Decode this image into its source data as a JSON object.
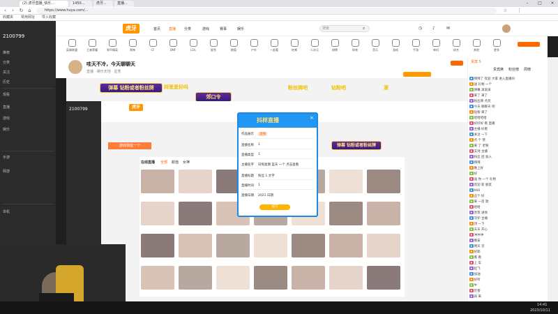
{
  "browser": {
    "tabs": [
      {
        "label": "(2) 虎牙直播_快乐..."
      },
      {
        "label": "1450..."
      },
      {
        "label": "虎牙..."
      },
      {
        "label": "直播..."
      }
    ],
    "url": "https://www.huya.com/...",
    "bookmarks": [
      "收藏夹",
      "常用网址",
      "导入收藏"
    ]
  },
  "sidebar": {
    "items": [
      "推荐",
      "分类",
      "关注",
      "历史",
      "观看",
      "直播",
      "游戏",
      "娱乐",
      "手游",
      "网游",
      "单机"
    ]
  },
  "topnav": {
    "logo": "虎牙",
    "links": [
      "首页",
      "直播",
      "分类",
      "游戏",
      "赛事",
      "娱乐"
    ],
    "search_placeholder": "搜索"
  },
  "categories": [
    "英雄联盟",
    "王者荣耀",
    "和平精英",
    "原神",
    "CF",
    "DNF",
    "LOL",
    "星秀",
    "颜值",
    "户外",
    "一起看",
    "吃喝",
    "二次元",
    "棋牌",
    "体育",
    "音乐",
    "游戏",
    "手游",
    "单机",
    "综合",
    "其他",
    "更多"
  ],
  "room": {
    "title": "哇天不冷，今天聊聊天",
    "subtitle": "直播 · 娱乐天地 · 星秀"
  },
  "overlay": {
    "ribbon1": "弹幕 钻粉或者粉丝牌",
    "text1": "拜里爱好吗",
    "ribbon2": "郊口令",
    "text2": "粉丝牌吧",
    "text3": "钻粉吧",
    "text4": "滚"
  },
  "inner": {
    "timer": "2100799",
    "banner": "弹幕 钻粉或者粉丝牌",
    "tag": "游戏我蓝一个",
    "section": "在线直播",
    "filters": [
      "全部",
      "颜值",
      "女神",
      "舞蹈",
      "唱歌",
      "聊天"
    ]
  },
  "dialog": {
    "title": "抖样直播",
    "tabs": [
      "作品展示",
      "直播"
    ],
    "rows": [
      {
        "label": "直播名称",
        "value": "1"
      },
      {
        "label": "直播类型",
        "value": "1"
      },
      {
        "label": "主播名字",
        "value": "日照星期 蓝天 一个 点击查看"
      },
      {
        "label": "直播标题",
        "value": "粉丝 1.文字"
      },
      {
        "label": "直播时间",
        "value": "1"
      },
      {
        "label": "直播日期",
        "value": "2021 日期"
      }
    ],
    "submit": "提交"
  },
  "chat": {
    "header": "贵宾 5",
    "tabs": [
      "贵宾席",
      "粉丝榜",
      "周榜"
    ],
    "lines": [
      "拜拜了 欢迎 大家 进入直播间",
      "送 礼物 一个",
      "弹幕 滚滚滚",
      "来了 来了",
      "粉丝牌 点亮",
      "今天 聊聊天 吧",
      "钻粉 来了",
      "哈哈哈哈",
      "好好好 看 直播",
      "主播 好看",
      "关注 一下",
      "点 个 赞",
      "来 了 老铁",
      "支持 主播",
      "粉丝 团 加入",
      "拜拜",
      "晚上好",
      "好",
      "送 你 一个 礼物",
      "欢迎 新 朋友",
      "666",
      "这个 好",
      "来 一首 歌",
      "哈哈",
      "贵宾 进场",
      "守护 主播",
      "顶 一下",
      "天天 开心",
      "冲冲冲",
      "晚安",
      "明天 见",
      "好耶",
      "看 看",
      "上 车",
      "起飞",
      "加油",
      "好听",
      "牛",
      "厉害",
      "再 来"
    ]
  },
  "clock": {
    "time": "14:41",
    "date": "2023/10/11"
  }
}
